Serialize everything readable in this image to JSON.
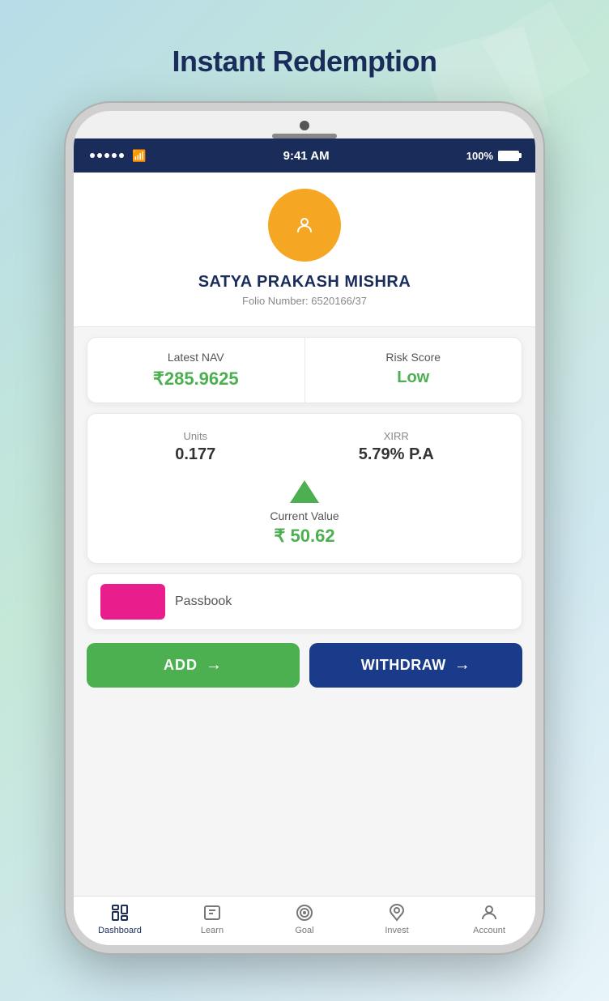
{
  "page": {
    "title": "Instant Redemption"
  },
  "status_bar": {
    "signal_dots": 5,
    "time": "9:41 AM",
    "battery_percent": "100%"
  },
  "profile": {
    "name": "SATYA PRAKASH MISHRA",
    "folio_label": "Folio Number:",
    "folio_number": "6520166/37"
  },
  "stats": {
    "nav_label": "Latest NAV",
    "nav_value": "₹285.9625",
    "risk_label": "Risk Score",
    "risk_value": "Low"
  },
  "investment": {
    "units_label": "Units",
    "units_value": "0.177",
    "xirr_label": "XIRR",
    "xirr_value": "5.79% P.A",
    "current_value_label": "Current Value",
    "current_value": "₹ 50.62"
  },
  "passbook": {
    "label": "Passbook"
  },
  "buttons": {
    "add_label": "ADD",
    "withdraw_label": "WITHDRAW"
  },
  "nav": {
    "items": [
      {
        "label": "Dashboard",
        "id": "dashboard",
        "active": true
      },
      {
        "label": "Learn",
        "id": "learn",
        "active": false
      },
      {
        "label": "Goal",
        "id": "goal",
        "active": false
      },
      {
        "label": "Invest",
        "id": "invest",
        "active": false
      },
      {
        "label": "Account",
        "id": "account",
        "active": false
      }
    ]
  }
}
